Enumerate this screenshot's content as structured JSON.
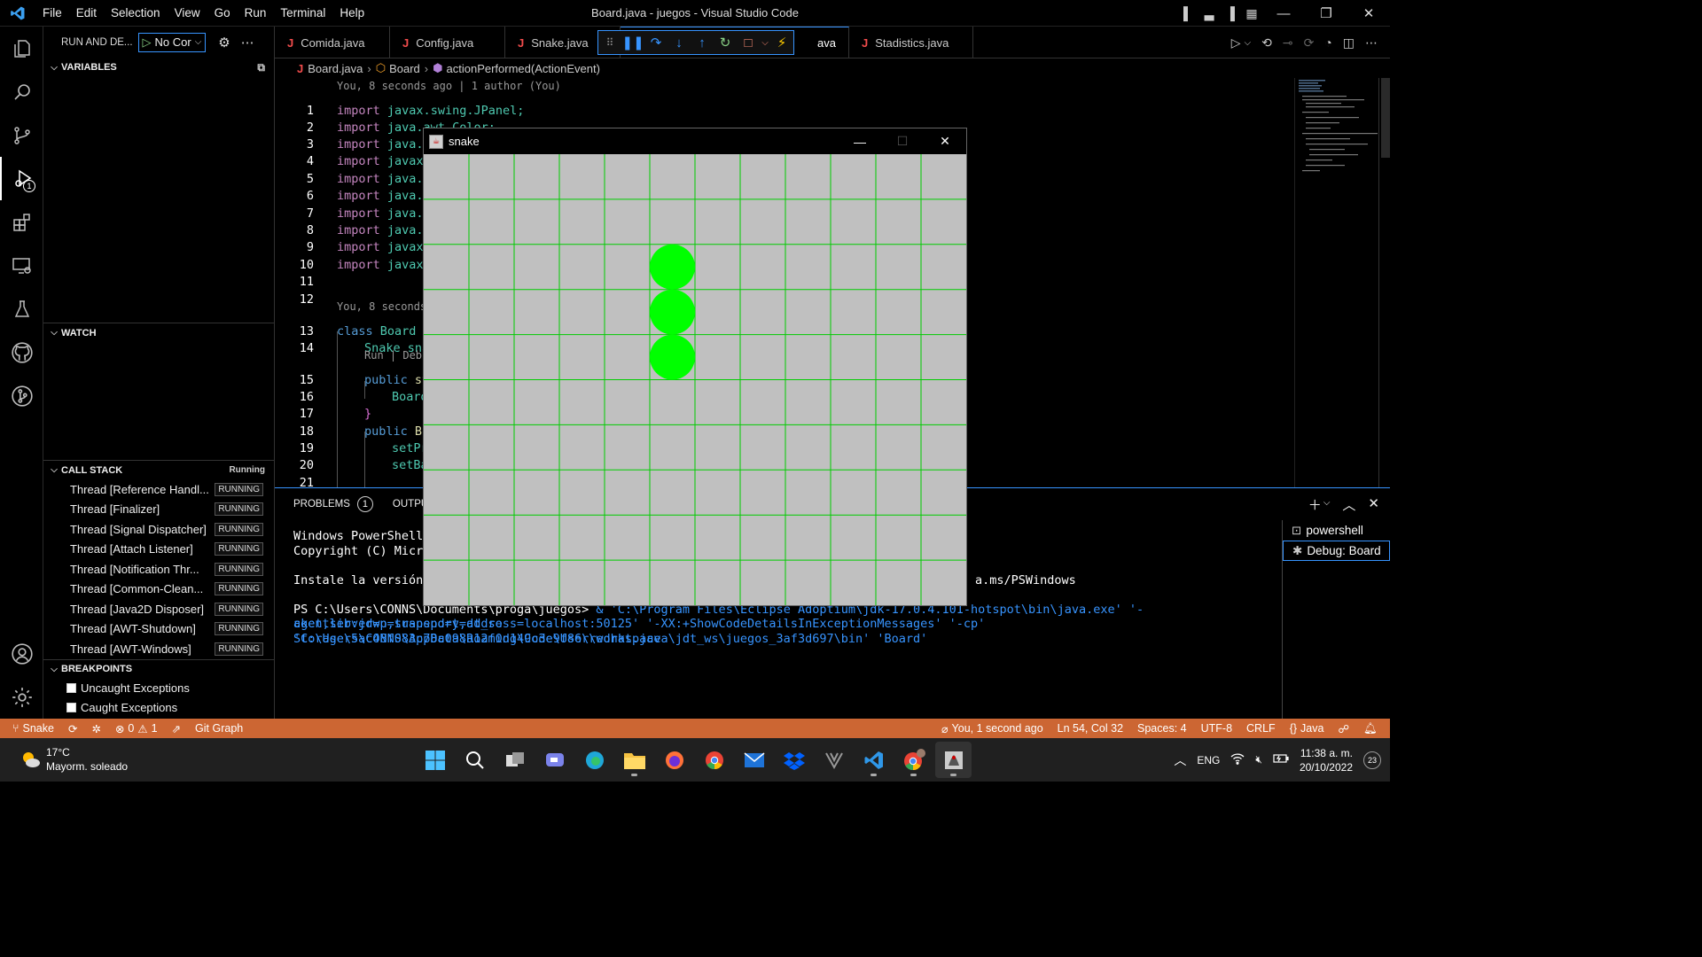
{
  "window": {
    "title": "Board.java - juegos - Visual Studio Code",
    "menu": [
      "File",
      "Edit",
      "Selection",
      "View",
      "Go",
      "Run",
      "Terminal",
      "Help"
    ]
  },
  "sidebar": {
    "header": "RUN AND DE...",
    "config": "No Cor",
    "variables_title": "VARIABLES",
    "watch_title": "WATCH",
    "callstack_title": "CALL STACK",
    "callstack_state": "Running",
    "threads": [
      {
        "name": "Thread [Reference Handl...",
        "status": "RUNNING"
      },
      {
        "name": "Thread [Finalizer]",
        "status": "RUNNING"
      },
      {
        "name": "Thread [Signal Dispatcher]",
        "status": "RUNNING"
      },
      {
        "name": "Thread [Attach Listener]",
        "status": "RUNNING"
      },
      {
        "name": "Thread [Notification Thr...",
        "status": "RUNNING"
      },
      {
        "name": "Thread [Common-Clean...",
        "status": "RUNNING"
      },
      {
        "name": "Thread [Java2D Disposer]",
        "status": "RUNNING"
      },
      {
        "name": "Thread [AWT-Shutdown]",
        "status": "RUNNING"
      },
      {
        "name": "Thread [AWT-Windows]",
        "status": "RUNNING"
      }
    ],
    "breakpoints_title": "BREAKPOINTS",
    "breakpoints": [
      "Uncaught Exceptions",
      "Caught Exceptions"
    ]
  },
  "activity_badge": "1",
  "tabs": [
    {
      "label": "Comida.java"
    },
    {
      "label": "Config.java"
    },
    {
      "label": "Snake.java"
    },
    {
      "label": "ava"
    },
    {
      "label": "Stadistics.java"
    }
  ],
  "breadcrumb": {
    "file": "Board.java",
    "class": "Board",
    "method": "actionPerformed(ActionEvent)"
  },
  "editor": {
    "lens_top": "You, 8 seconds ago | 1 author (You)",
    "lens_mid": "You, 8 seconds ag",
    "lens_run": "Run | Debug",
    "lines": [
      {
        "n": "1",
        "kw": "import",
        "rest": "javax.swing.JPanel;"
      },
      {
        "n": "2",
        "kw": "import",
        "rest": "java.awt.Color;"
      },
      {
        "n": "3",
        "kw": "import",
        "rest": "java.a"
      },
      {
        "n": "4",
        "kw": "import",
        "rest": "javax"
      },
      {
        "n": "5",
        "kw": "import",
        "rest": "java.a"
      },
      {
        "n": "6",
        "kw": "import",
        "rest": "java.a"
      },
      {
        "n": "7",
        "kw": "import",
        "rest": "java.u"
      },
      {
        "n": "8",
        "kw": "import",
        "rest": "java.a"
      },
      {
        "n": "9",
        "kw": "import",
        "rest": "javax"
      },
      {
        "n": "10",
        "kw": "import",
        "rest": "javax"
      },
      {
        "n": "11",
        "kw": "",
        "rest": ""
      },
      {
        "n": "12",
        "kw": "",
        "rest": ""
      },
      {
        "n": "13",
        "kw": "class",
        "rest": "Board e"
      },
      {
        "n": "14",
        "kw": "",
        "rest": "Snake sna"
      },
      {
        "n": "15",
        "kw": "public",
        "rest": "st"
      },
      {
        "n": "16",
        "kw": "",
        "rest": "Board"
      },
      {
        "n": "17",
        "kw": "",
        "rest": "}"
      },
      {
        "n": "18",
        "kw": "public",
        "rest": "Bo"
      },
      {
        "n": "19",
        "kw": "",
        "rest": "setPr"
      },
      {
        "n": "20",
        "kw": "",
        "rest": "setBa"
      },
      {
        "n": "21",
        "kw": "",
        "rest": ""
      }
    ]
  },
  "panel": {
    "tabs": [
      "PROBLEMS",
      "OUTPUT"
    ],
    "problems_count": "1",
    "terminal_lines": [
      "Windows PowerShell",
      "Copyright (C) Micros",
      "",
      "Instale la versión m",
      "",
      "PS C:\\Users\\CONNS\\Documents\\proga\\juegos>"
    ],
    "terminal_tail_line4": "a.ms/PSWindows",
    "terminal_cmd_line1": "& 'C:\\Program Files\\Eclipse Adoptium\\jdk-17.0.4.101-hotspot\\bin\\java.exe' '-agentlib:jdwp=transport=dt_so",
    "terminal_cmd_line2": "cket,server=n,suspend=y,address=localhost:50125' '-XX:+ShowCodeDetailsInExceptionMessages' '-cp' 'C:\\Users\\CONNS\\AppData\\Roaming\\Code\\User\\workspace",
    "terminal_cmd_line3": "Storage\\5ac48f083c78c098a12f0d149c3e9f86\\redhat.java\\jdt_ws\\juegos_3af3d697\\bin' 'Board'",
    "terminals": [
      "powershell",
      "Debug: Board"
    ]
  },
  "statusbar": {
    "branch": "Snake",
    "errors": "0",
    "warnings": "1",
    "git_graph": "Git Graph",
    "blame": "You, 1 second ago",
    "position": "Ln 54, Col 32",
    "spaces": "Spaces: 4",
    "encoding": "UTF-8",
    "eol": "CRLF",
    "language": "Java",
    "color": "#cc6633"
  },
  "snake_window": {
    "title": "snake",
    "grid_cols": 12,
    "grid_rows": 10,
    "board_color": "#c0c0c0",
    "grid_color": "#00cc00",
    "snake_color": "#00ff00",
    "snake_cells": [
      [
        5,
        2
      ],
      [
        5,
        3
      ],
      [
        5,
        4
      ]
    ]
  },
  "taskbar": {
    "temp": "17°C",
    "weather": "Mayorm. soleado",
    "lang": "ENG",
    "time": "11:38 a. m.",
    "date": "20/10/2022",
    "notif": "23"
  }
}
